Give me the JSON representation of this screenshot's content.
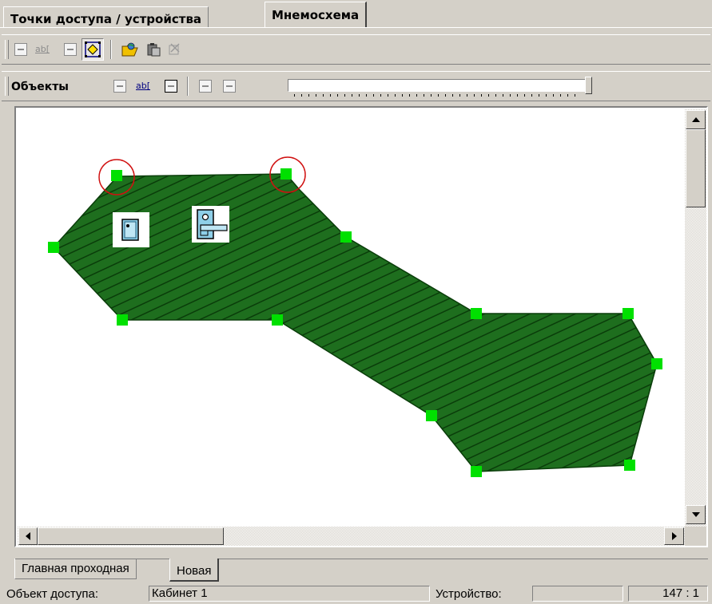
{
  "tabs": {
    "devices_label": "Точки доступа / устройства",
    "mnemo_label": "Мнемосхема"
  },
  "toolbar2": {
    "objects_label": "Объекты"
  },
  "colors": {
    "zone_fill": "#1e6e1e",
    "zone_hatch": "#0a3d0a",
    "vertex": "#00e000",
    "highlight_circle": "#d01010"
  },
  "sheets": {
    "tab_main_label": "Главная проходная",
    "tab_new_label": "Новая"
  },
  "status": {
    "object_label": "Объект доступа:",
    "object_value": "Кабинет 1",
    "device_label": "Устройство:",
    "device_value": "",
    "coords": "147 : 1"
  }
}
